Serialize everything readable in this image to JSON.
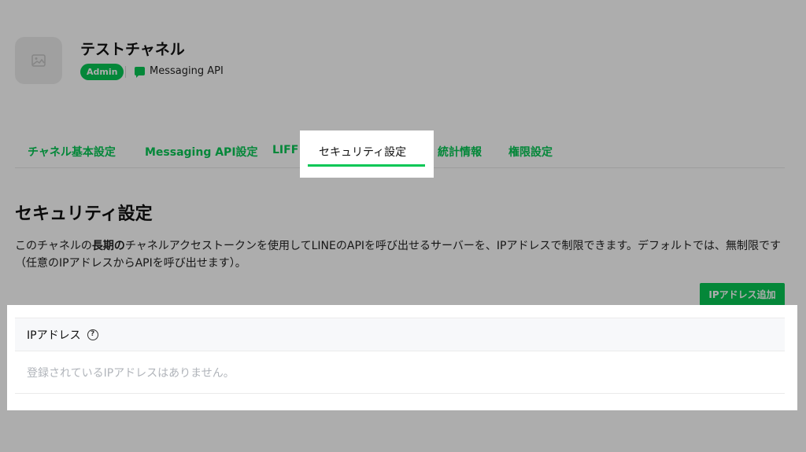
{
  "channel": {
    "title": "テストチャネル",
    "role_badge": "Admin",
    "type_label": "Messaging API",
    "thumbnail_icon": "image-placeholder-icon",
    "type_icon": "chat-bubble-icon"
  },
  "tabs": [
    {
      "label": "チャネル基本設定",
      "active": false
    },
    {
      "label": "Messaging API設定",
      "active": false
    },
    {
      "label": "LIFF",
      "active": false
    },
    {
      "label": "セキュリティ設定",
      "active": true
    },
    {
      "label": "統計情報",
      "active": false
    },
    {
      "label": "権限設定",
      "active": false
    }
  ],
  "section": {
    "title": "セキュリティ設定",
    "desc_1": "このチャネルの",
    "desc_bold": "長期の",
    "desc_2": "チャネルアクセストークンを使用してLINEのAPIを呼び出せるサーバーを、IPアドレスで制限できます。デフォルトでは、無制限です（任意のIPアドレスからAPIを呼び出せます）。"
  },
  "add_button": {
    "label": "IPアドレス追加"
  },
  "ip_table": {
    "header": "IPアドレス",
    "help_icon": "question-circle-icon",
    "empty_text": "登録されているIPアドレスはありません。"
  },
  "colors": {
    "accent": "#06c755",
    "overlay": "rgba(0,0,0,0.32)"
  }
}
